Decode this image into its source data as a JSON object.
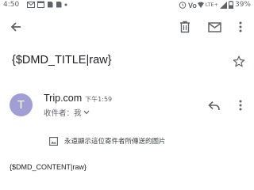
{
  "status_bar": {
    "time": "4:50",
    "network_label": "LTE+",
    "battery": "39%",
    "left_icons": [
      "gmail-icon",
      "calendar-icon",
      "photo-icon",
      "notification-dot-icon"
    ],
    "right_icons": [
      "alarm-icon",
      "vowifi-icon",
      "signal-icon",
      "battery-icon"
    ]
  },
  "toolbar": {
    "actions": [
      "back-icon",
      "delete-icon",
      "mail-unread-icon",
      "more-icon"
    ]
  },
  "email": {
    "subject": "{$DMD_TITLE|raw}",
    "sender_initial": "T",
    "sender_name": "Trip.com",
    "time": "下午1:59",
    "recipient": "收件者：我",
    "show_images_label": "永遠顯示這位寄件者所傳送的圖片",
    "body": "{$DMD_CONTENT|raw}"
  },
  "colors": {
    "avatar_bg": "#a19ed6",
    "icon_gray": "#5f6368",
    "text_dark": "#202124"
  }
}
